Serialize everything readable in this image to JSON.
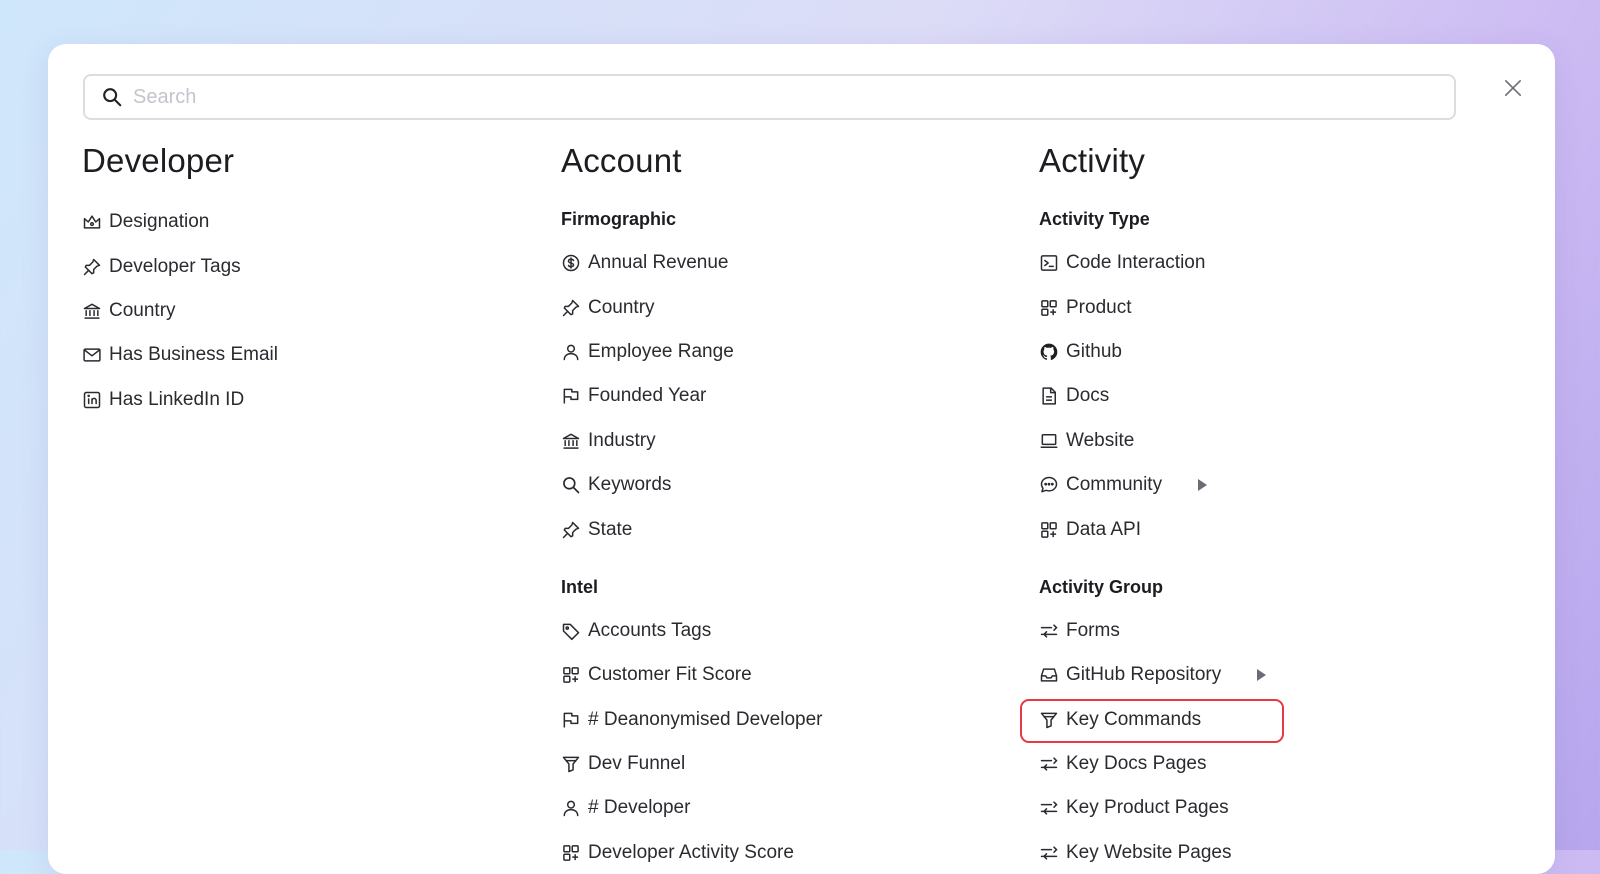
{
  "search": {
    "placeholder": "Search"
  },
  "columns": {
    "developer": {
      "title": "Developer",
      "items": [
        {
          "label": "Designation",
          "icon": "crown-icon"
        },
        {
          "label": "Developer Tags",
          "icon": "pin-icon"
        },
        {
          "label": "Country",
          "icon": "bank-icon"
        },
        {
          "label": "Has Business Email",
          "icon": "mail-icon"
        },
        {
          "label": "Has LinkedIn ID",
          "icon": "linkedin-icon"
        }
      ]
    },
    "account": {
      "title": "Account",
      "groups": [
        {
          "title": "Firmographic",
          "items": [
            {
              "label": "Annual Revenue",
              "icon": "dollar-circle-icon"
            },
            {
              "label": "Country",
              "icon": "pin-icon"
            },
            {
              "label": "Employee Range",
              "icon": "user-icon"
            },
            {
              "label": "Founded Year",
              "icon": "flag-icon"
            },
            {
              "label": "Industry",
              "icon": "bank-icon"
            },
            {
              "label": "Keywords",
              "icon": "search-icon"
            },
            {
              "label": "State",
              "icon": "pin-icon"
            }
          ]
        },
        {
          "title": "Intel",
          "items": [
            {
              "label": "Accounts Tags",
              "icon": "tag-icon"
            },
            {
              "label": "Customer Fit Score",
              "icon": "grid-icon"
            },
            {
              "label": "# Deanonymised Developer",
              "icon": "flag-icon"
            },
            {
              "label": "Dev Funnel",
              "icon": "funnel-icon"
            },
            {
              "label": "# Developer",
              "icon": "user-icon"
            },
            {
              "label": "Developer Activity Score",
              "icon": "grid-icon"
            }
          ]
        }
      ]
    },
    "activity": {
      "title": "Activity",
      "groups": [
        {
          "title": "Activity Type",
          "items": [
            {
              "label": "Code Interaction",
              "icon": "terminal-icon"
            },
            {
              "label": "Product",
              "icon": "grid-icon"
            },
            {
              "label": "Github",
              "icon": "github-icon"
            },
            {
              "label": "Docs",
              "icon": "document-icon"
            },
            {
              "label": "Website",
              "icon": "laptop-icon"
            },
            {
              "label": "Community",
              "icon": "chat-icon",
              "has_submenu": true
            },
            {
              "label": "Data API",
              "icon": "grid-icon"
            }
          ]
        },
        {
          "title": "Activity Group",
          "items": [
            {
              "label": "Forms",
              "icon": "filter-lines-icon"
            },
            {
              "label": "GitHub Repository",
              "icon": "inbox-icon",
              "has_submenu": true
            },
            {
              "label": "Key Commands",
              "icon": "funnel-icon",
              "highlighted": true
            },
            {
              "label": "Key Docs Pages",
              "icon": "filter-lines-icon"
            },
            {
              "label": "Key Product Pages",
              "icon": "filter-lines-icon"
            },
            {
              "label": "Key Website Pages",
              "icon": "filter-lines-icon"
            }
          ]
        }
      ]
    }
  },
  "colors": {
    "highlight": "#e53945",
    "text": "#2a2b30"
  }
}
